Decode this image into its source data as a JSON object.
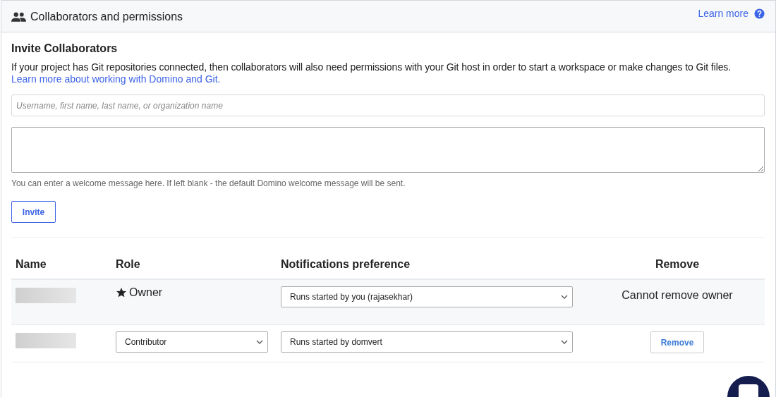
{
  "header": {
    "title": "Collaborators and permissions",
    "learn_more": "Learn more"
  },
  "invite": {
    "heading": "Invite Collaborators",
    "description": "If your project has Git repositories connected, then collaborators will also need permissions with your Git host in order to start a workspace or make changes to Git files.",
    "link": "Learn more about working with Domino and Git.",
    "search_placeholder": "Username, first name, last name, or organization name",
    "message_hint": "You can enter a welcome message here. If left blank - the default Domino welcome message will be sent.",
    "button": "Invite"
  },
  "table": {
    "columns": [
      "Name",
      "Role",
      "Notifications preference",
      "Remove"
    ],
    "rows": [
      {
        "kind": "owner",
        "role": "Owner",
        "notifications": "Runs started by you (rajasekhar)",
        "remove": "Cannot remove owner"
      },
      {
        "kind": "member",
        "role": "Contributor",
        "notifications": "Runs started by domvert",
        "remove": "Remove"
      }
    ]
  }
}
